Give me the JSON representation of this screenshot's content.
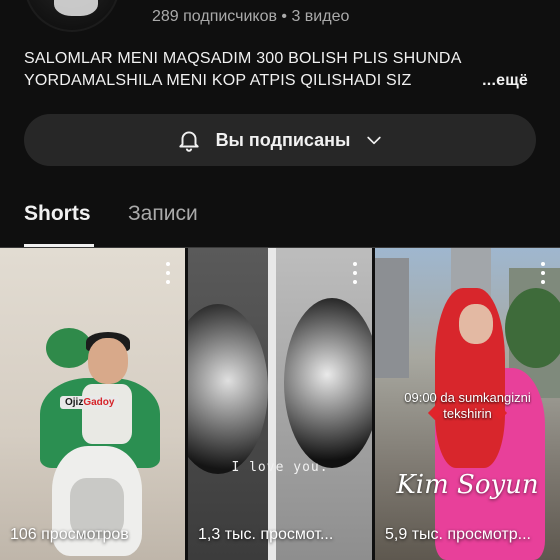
{
  "channel": {
    "stats": "289 подписчиков • 3 видео",
    "description_line1": "SALOMLAR MENI MAQSADIM 300 BOLISH PLIS SHUNDA",
    "description_line2": "YORDAMALSHILA MENI KOP ATPIS QILISHADI SIZ",
    "description_more": "...ещё"
  },
  "subscribe": {
    "label": "Вы подписаны",
    "icon": "bell-icon",
    "dropdown_icon": "chevron-down-icon"
  },
  "tabs": [
    {
      "label": "Shorts",
      "active": true
    },
    {
      "label": "Записи",
      "active": false
    }
  ],
  "shorts": [
    {
      "views": "106 просмотров",
      "overlay": {
        "prefix": "Ojiz",
        "highlight": "Gadoy"
      }
    },
    {
      "views": "1,3 тыс. просмот...",
      "overlay_text": "I love you."
    },
    {
      "views": "5,9 тыс. просмотр...",
      "caption_line1": "09:00 da sumkangizni",
      "caption_line2": "tekshirin",
      "script_text": "Kim Soyun"
    }
  ],
  "colors": {
    "background": "#0f0f0f",
    "text_primary": "#f1f1f1",
    "text_secondary": "#aaaaaa",
    "button_bg": "#272727"
  }
}
